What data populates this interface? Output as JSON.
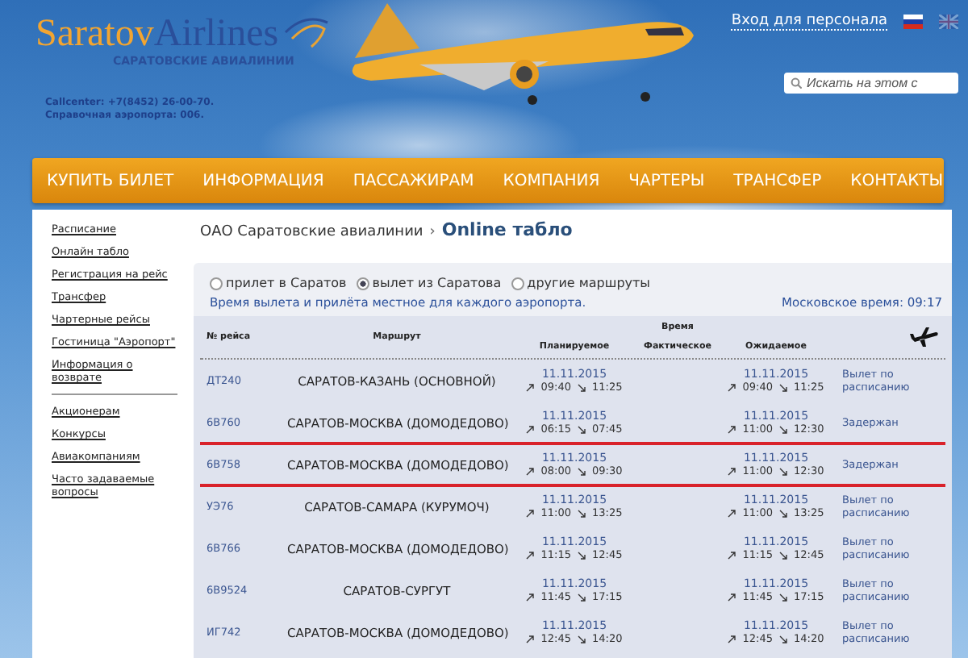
{
  "header": {
    "logo": {
      "brand_a": "Saratov",
      "brand_b": "Airlines",
      "subtitle": "САРАТОВСКИЕ АВИАЛИНИИ"
    },
    "contacts": [
      "Callcenter: +7(8452) 26-00-70.",
      "Справочная аэропорта: 006."
    ],
    "staff_login": "Вход для персонала",
    "languages": [
      {
        "kind": "ru",
        "selected": true
      },
      {
        "kind": "en",
        "selected": false
      }
    ],
    "search": {
      "placeholder": "Искать на этом с"
    }
  },
  "nav": [
    "КУПИТЬ БИЛЕТ",
    "ИНФОРМАЦИЯ",
    "ПАССАЖИРАМ",
    "КОМПАНИЯ",
    "ЧАРТЕРЫ",
    "ТРАНСФЕР",
    "КОНТАКТЫ"
  ],
  "sidebar": {
    "groups": [
      [
        "Расписание",
        "Онлайн табло",
        "Регистрация на рейс",
        "Трансфер",
        "Чартерные рейсы",
        "Гостиница \"Аэропорт\"",
        "Информация о возврате"
      ],
      [
        "Акционерам",
        "Конкурсы",
        "Авиакомпаниям",
        "Часто задаваемые вопросы"
      ]
    ]
  },
  "breadcrumb": {
    "parent": "ОАО Саратовские авиалинии",
    "separator": "›",
    "current": "Online табло"
  },
  "board": {
    "modes": [
      {
        "label": "прилет в Саратов",
        "selected": false
      },
      {
        "label": "вылет из Саратова",
        "selected": true
      },
      {
        "label": "другие маршруты",
        "selected": false
      }
    ],
    "note": "Время вылета и прилёта местное для каждого аэропорта.",
    "moscow_time_label": "Московское время:",
    "moscow_time": "09:17",
    "columns": {
      "flight": "№ рейса",
      "route": "Маршрут",
      "time": "Время",
      "planned": "Планируемое",
      "actual": "Фактическое",
      "expected": "Ожидаемое"
    },
    "rows": [
      {
        "flight": "ДТ240",
        "route": "САРАТОВ-КАЗАНЬ (ОСНОВНОЙ)",
        "planned": {
          "date": "11.11.2015",
          "dep": "09:40",
          "arr": "11:25"
        },
        "expected": {
          "date": "11.11.2015",
          "dep": "09:40",
          "arr": "11:25"
        },
        "status": "Вылет по расписанию",
        "highlighted": false
      },
      {
        "flight": "6В760",
        "route": "САРАТОВ-МОСКВА (ДОМОДЕДОВО)",
        "planned": {
          "date": "11.11.2015",
          "dep": "06:15",
          "arr": "07:45"
        },
        "expected": {
          "date": "11.11.2015",
          "dep": "11:00",
          "arr": "12:30"
        },
        "status": "Задержан",
        "highlighted": false
      },
      {
        "flight": "6В758",
        "route": "САРАТОВ-МОСКВА (ДОМОДЕДОВО)",
        "planned": {
          "date": "11.11.2015",
          "dep": "08:00",
          "arr": "09:30"
        },
        "expected": {
          "date": "11.11.2015",
          "dep": "11:00",
          "arr": "12:30"
        },
        "status": "Задержан",
        "highlighted": true
      },
      {
        "flight": "УЭ76",
        "route": "САРАТОВ-САМАРА (КУРУМОЧ)",
        "planned": {
          "date": "11.11.2015",
          "dep": "11:00",
          "arr": "13:25"
        },
        "expected": {
          "date": "11.11.2015",
          "dep": "11:00",
          "arr": "13:25"
        },
        "status": "Вылет по расписанию",
        "highlighted": false
      },
      {
        "flight": "6В766",
        "route": "САРАТОВ-МОСКВА (ДОМОДЕДОВО)",
        "planned": {
          "date": "11.11.2015",
          "dep": "11:15",
          "arr": "12:45"
        },
        "expected": {
          "date": "11.11.2015",
          "dep": "11:15",
          "arr": "12:45"
        },
        "status": "Вылет по расписанию",
        "highlighted": false
      },
      {
        "flight": "6В9524",
        "route": "САРАТОВ-СУРГУТ",
        "planned": {
          "date": "11.11.2015",
          "dep": "11:45",
          "arr": "17:15"
        },
        "expected": {
          "date": "11.11.2015",
          "dep": "11:45",
          "arr": "17:15"
        },
        "status": "Вылет по расписанию",
        "highlighted": false
      },
      {
        "flight": "ИГ742",
        "route": "САРАТОВ-МОСКВА (ДОМОДЕДОВО)",
        "planned": {
          "date": "11.11.2015",
          "dep": "12:45",
          "arr": "14:20"
        },
        "expected": {
          "date": "11.11.2015",
          "dep": "12:45",
          "arr": "14:20"
        },
        "status": "Вылет по расписанию",
        "highlighted": false
      }
    ]
  }
}
